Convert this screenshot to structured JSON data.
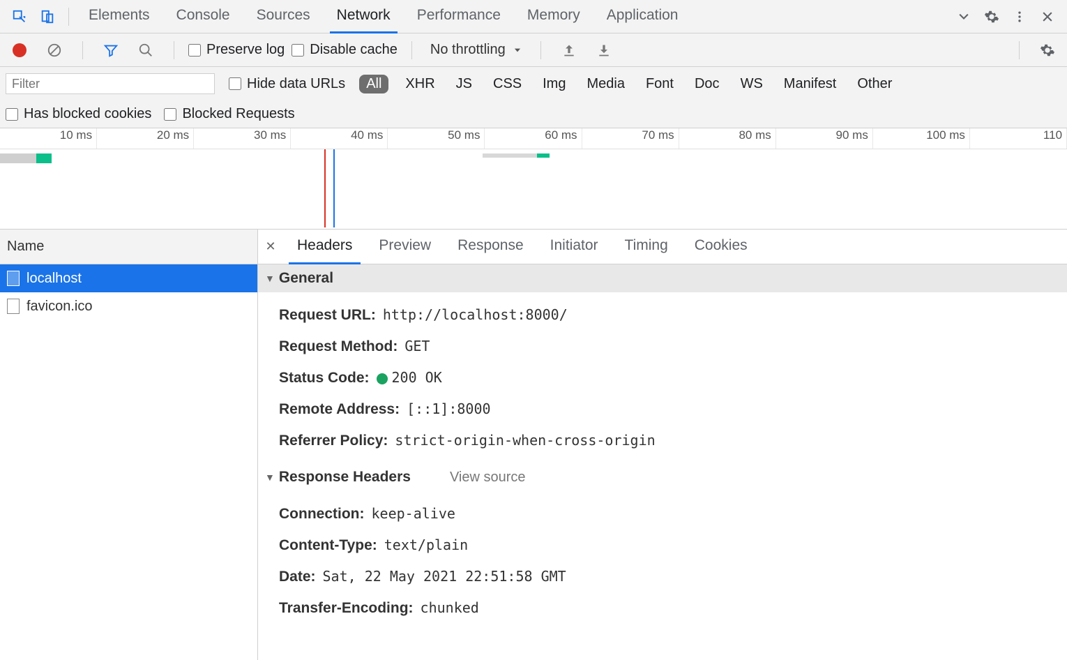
{
  "topTabs": [
    "Elements",
    "Console",
    "Sources",
    "Network",
    "Performance",
    "Memory",
    "Application"
  ],
  "topActive": "Network",
  "preserveLog": "Preserve log",
  "disableCache": "Disable cache",
  "throttling": "No throttling",
  "filterPlaceholder": "Filter",
  "hideDataUrls": "Hide data URLs",
  "filterPills": [
    "All",
    "XHR",
    "JS",
    "CSS",
    "Img",
    "Media",
    "Font",
    "Doc",
    "WS",
    "Manifest",
    "Other"
  ],
  "filterActive": "All",
  "hasBlockedCookies": "Has blocked cookies",
  "blockedRequests": "Blocked Requests",
  "timelineTicks": [
    "10 ms",
    "20 ms",
    "30 ms",
    "40 ms",
    "50 ms",
    "60 ms",
    "70 ms",
    "80 ms",
    "90 ms",
    "100 ms",
    "110 "
  ],
  "nameHeader": "Name",
  "requests": [
    {
      "name": "localhost",
      "selected": true
    },
    {
      "name": "favicon.ico",
      "selected": false
    }
  ],
  "detailTabs": [
    "Headers",
    "Preview",
    "Response",
    "Initiator",
    "Timing",
    "Cookies"
  ],
  "detailActive": "Headers",
  "generalLabel": "General",
  "responseHeadersLabel": "Response Headers",
  "viewSource": "View source",
  "general": {
    "requestUrlK": "Request URL:",
    "requestUrlV": "http://localhost:8000/",
    "methodK": "Request Method:",
    "methodV": "GET",
    "statusK": "Status Code:",
    "statusV": "200 OK",
    "remoteK": "Remote Address:",
    "remoteV": "[::1]:8000",
    "referrerK": "Referrer Policy:",
    "referrerV": "strict-origin-when-cross-origin"
  },
  "respHeaders": {
    "connK": "Connection:",
    "connV": "keep-alive",
    "ctK": "Content-Type:",
    "ctV": "text/plain",
    "dateK": "Date:",
    "dateV": "Sat, 22 May 2021 22:51:58 GMT",
    "teK": "Transfer-Encoding:",
    "teV": "chunked"
  }
}
